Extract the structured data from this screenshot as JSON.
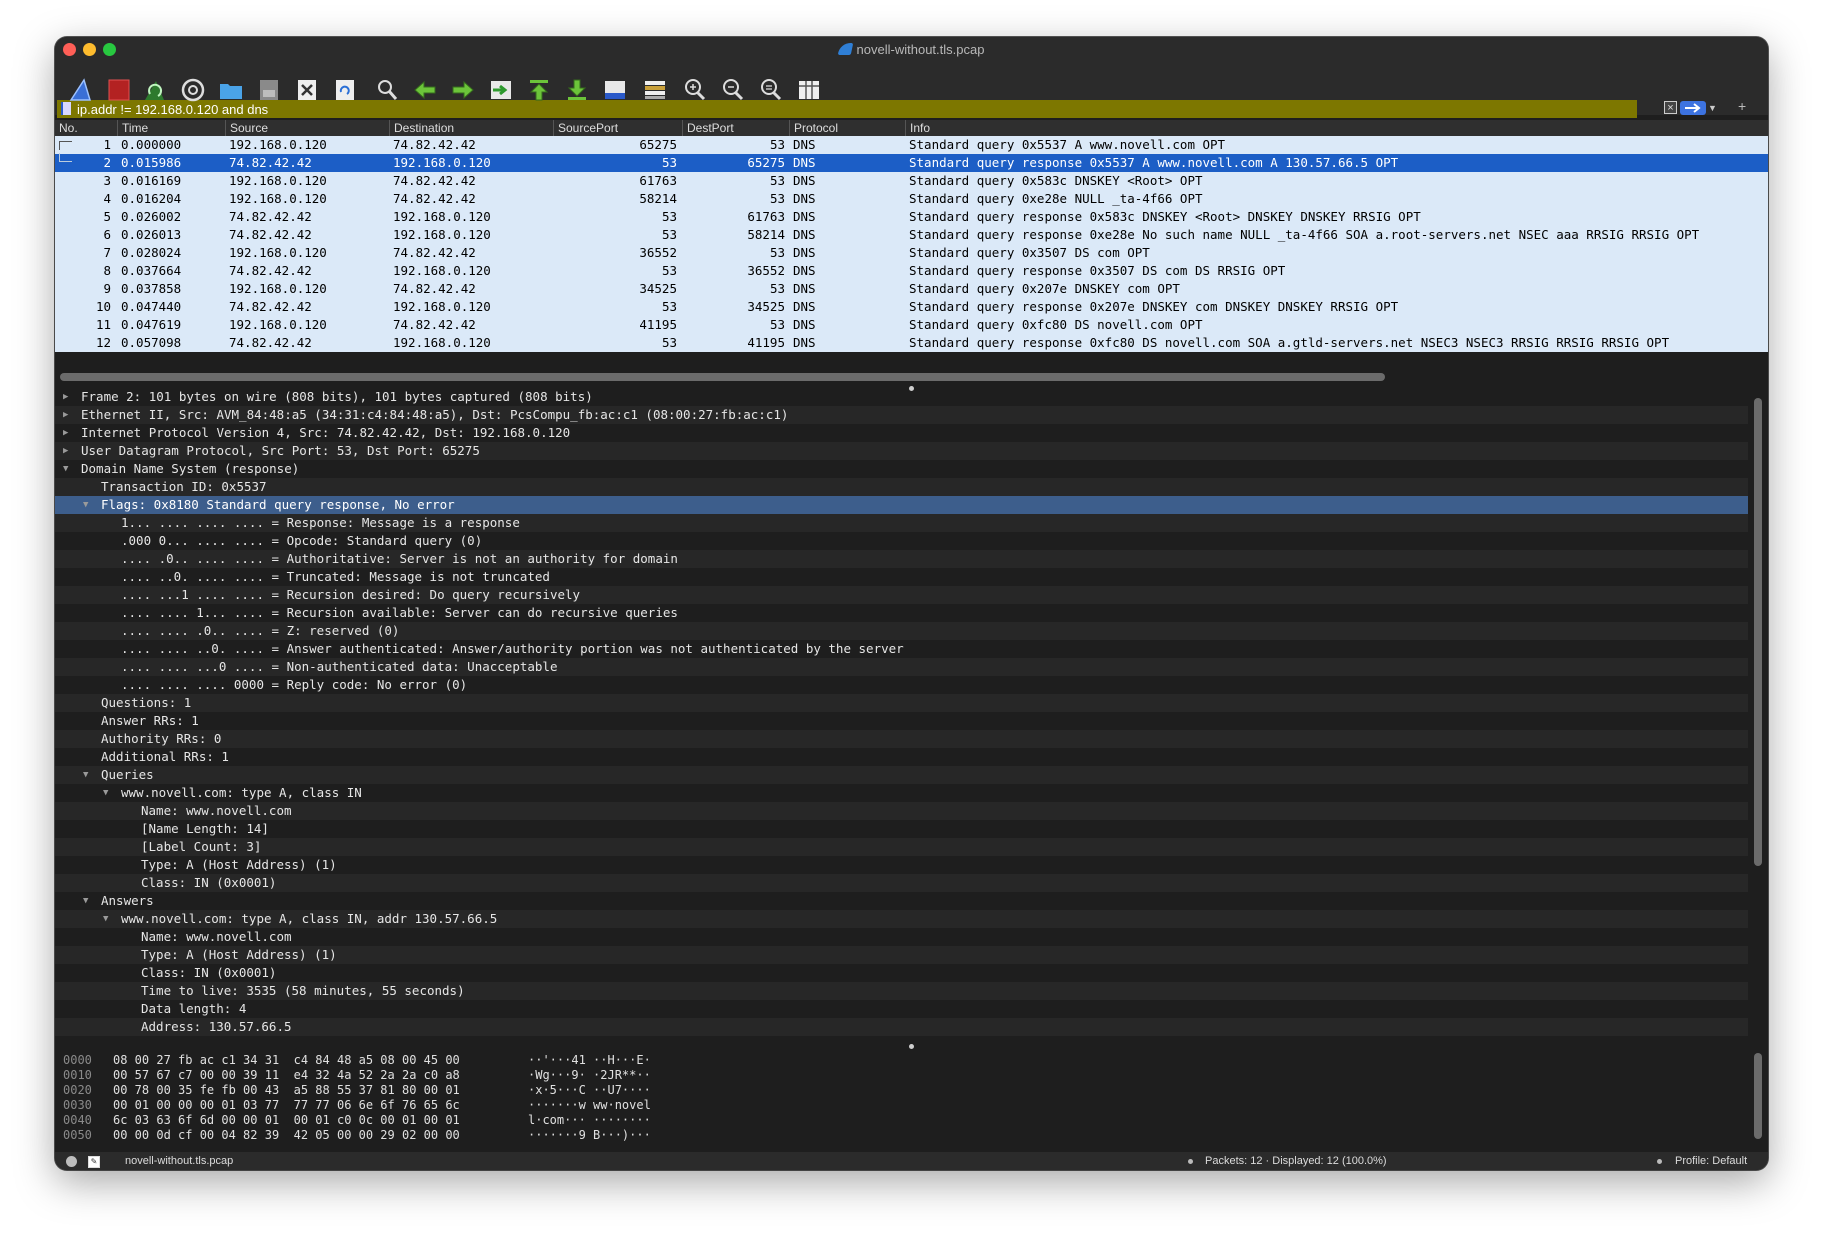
{
  "window": {
    "title": "novell-without.tls.pcap"
  },
  "toolbar": {
    "buttons": [
      {
        "name": "start-capture-icon",
        "label": "Start capture"
      },
      {
        "name": "stop-capture-icon",
        "label": "Stop capture"
      },
      {
        "name": "restart-capture-icon",
        "label": "Restart capture"
      },
      {
        "name": "capture-options-icon",
        "label": "Capture options"
      },
      {
        "name": "open-file-icon",
        "label": "Open"
      },
      {
        "name": "save-file-icon",
        "label": "Save"
      },
      {
        "name": "close-file-icon",
        "label": "Close"
      },
      {
        "name": "reload-file-icon",
        "label": "Reload"
      },
      {
        "name": "find-packet-icon",
        "label": "Find"
      },
      {
        "name": "go-back-icon",
        "label": "Back"
      },
      {
        "name": "go-forward-icon",
        "label": "Forward"
      },
      {
        "name": "go-to-packet-icon",
        "label": "Go to packet"
      },
      {
        "name": "first-packet-icon",
        "label": "First"
      },
      {
        "name": "last-packet-icon",
        "label": "Last"
      },
      {
        "name": "auto-scroll-icon",
        "label": "Auto scroll"
      },
      {
        "name": "colorize-icon",
        "label": "Colorize"
      },
      {
        "name": "zoom-in-icon",
        "label": "Zoom in"
      },
      {
        "name": "zoom-out-icon",
        "label": "Zoom out"
      },
      {
        "name": "zoom-reset-icon",
        "label": "Normal size"
      },
      {
        "name": "resize-columns-icon",
        "label": "Resize columns"
      }
    ]
  },
  "filter": {
    "value": "ip.addr != 192.168.0.120 and dns"
  },
  "packet_list": {
    "columns": [
      "No.",
      "Time",
      "Source",
      "Destination",
      "SourcePort",
      "DestPort",
      "Protocol",
      "Info"
    ],
    "rows": [
      {
        "no": "1",
        "time": "0.000000",
        "src": "192.168.0.120",
        "dst": "74.82.42.42",
        "sport": "65275",
        "dport": "53",
        "proto": "DNS",
        "info": "Standard query 0x5537 A www.novell.com OPT"
      },
      {
        "no": "2",
        "time": "0.015986",
        "src": "74.82.42.42",
        "dst": "192.168.0.120",
        "sport": "53",
        "dport": "65275",
        "proto": "DNS",
        "info": "Standard query response 0x5537 A www.novell.com A 130.57.66.5 OPT"
      },
      {
        "no": "3",
        "time": "0.016169",
        "src": "192.168.0.120",
        "dst": "74.82.42.42",
        "sport": "61763",
        "dport": "53",
        "proto": "DNS",
        "info": "Standard query 0x583c DNSKEY <Root> OPT"
      },
      {
        "no": "4",
        "time": "0.016204",
        "src": "192.168.0.120",
        "dst": "74.82.42.42",
        "sport": "58214",
        "dport": "53",
        "proto": "DNS",
        "info": "Standard query 0xe28e NULL _ta-4f66 OPT"
      },
      {
        "no": "5",
        "time": "0.026002",
        "src": "74.82.42.42",
        "dst": "192.168.0.120",
        "sport": "53",
        "dport": "61763",
        "proto": "DNS",
        "info": "Standard query response 0x583c DNSKEY <Root> DNSKEY DNSKEY RRSIG OPT"
      },
      {
        "no": "6",
        "time": "0.026013",
        "src": "74.82.42.42",
        "dst": "192.168.0.120",
        "sport": "53",
        "dport": "58214",
        "proto": "DNS",
        "info": "Standard query response 0xe28e No such name NULL _ta-4f66 SOA a.root-servers.net NSEC aaa RRSIG RRSIG OPT"
      },
      {
        "no": "7",
        "time": "0.028024",
        "src": "192.168.0.120",
        "dst": "74.82.42.42",
        "sport": "36552",
        "dport": "53",
        "proto": "DNS",
        "info": "Standard query 0x3507 DS com OPT"
      },
      {
        "no": "8",
        "time": "0.037664",
        "src": "74.82.42.42",
        "dst": "192.168.0.120",
        "sport": "53",
        "dport": "36552",
        "proto": "DNS",
        "info": "Standard query response 0x3507 DS com DS RRSIG OPT"
      },
      {
        "no": "9",
        "time": "0.037858",
        "src": "192.168.0.120",
        "dst": "74.82.42.42",
        "sport": "34525",
        "dport": "53",
        "proto": "DNS",
        "info": "Standard query 0x207e DNSKEY com OPT"
      },
      {
        "no": "10",
        "time": "0.047440",
        "src": "74.82.42.42",
        "dst": "192.168.0.120",
        "sport": "53",
        "dport": "34525",
        "proto": "DNS",
        "info": "Standard query response 0x207e DNSKEY com DNSKEY DNSKEY RRSIG OPT"
      },
      {
        "no": "11",
        "time": "0.047619",
        "src": "192.168.0.120",
        "dst": "74.82.42.42",
        "sport": "41195",
        "dport": "53",
        "proto": "DNS",
        "info": "Standard query 0xfc80 DS novell.com OPT"
      },
      {
        "no": "12",
        "time": "0.057098",
        "src": "74.82.42.42",
        "dst": "192.168.0.120",
        "sport": "53",
        "dport": "41195",
        "proto": "DNS",
        "info": "Standard query response 0xfc80 DS novell.com SOA a.gtld-servers.net NSEC3 NSEC3 RRSIG RRSIG RRSIG OPT"
      }
    ],
    "selected_row": 2
  },
  "details": [
    {
      "text": "Frame 2: 101 bytes on wire (808 bits), 101 bytes captured (808 bits)",
      "level": 0,
      "tri": "closed"
    },
    {
      "text": "Ethernet II, Src: AVM_84:48:a5 (34:31:c4:84:48:a5), Dst: PcsCompu_fb:ac:c1 (08:00:27:fb:ac:c1)",
      "level": 0,
      "tri": "closed"
    },
    {
      "text": "Internet Protocol Version 4, Src: 74.82.42.42, Dst: 192.168.0.120",
      "level": 0,
      "tri": "closed"
    },
    {
      "text": "User Datagram Protocol, Src Port: 53, Dst Port: 65275",
      "level": 0,
      "tri": "closed"
    },
    {
      "text": "Domain Name System (response)",
      "level": 0,
      "tri": "open"
    },
    {
      "text": "Transaction ID: 0x5537",
      "level": 1,
      "tri": ""
    },
    {
      "text": "Flags: 0x8180 Standard query response, No error",
      "level": 1,
      "tri": "open",
      "selected": true
    },
    {
      "text": "1... .... .... .... = Response: Message is a response",
      "level": 2,
      "tri": ""
    },
    {
      "text": ".000 0... .... .... = Opcode: Standard query (0)",
      "level": 2,
      "tri": ""
    },
    {
      "text": ".... .0.. .... .... = Authoritative: Server is not an authority for domain",
      "level": 2,
      "tri": ""
    },
    {
      "text": ".... ..0. .... .... = Truncated: Message is not truncated",
      "level": 2,
      "tri": ""
    },
    {
      "text": ".... ...1 .... .... = Recursion desired: Do query recursively",
      "level": 2,
      "tri": ""
    },
    {
      "text": ".... .... 1... .... = Recursion available: Server can do recursive queries",
      "level": 2,
      "tri": ""
    },
    {
      "text": ".... .... .0.. .... = Z: reserved (0)",
      "level": 2,
      "tri": ""
    },
    {
      "text": ".... .... ..0. .... = Answer authenticated: Answer/authority portion was not authenticated by the server",
      "level": 2,
      "tri": ""
    },
    {
      "text": ".... .... ...0 .... = Non-authenticated data: Unacceptable",
      "level": 2,
      "tri": ""
    },
    {
      "text": ".... .... .... 0000 = Reply code: No error (0)",
      "level": 2,
      "tri": ""
    },
    {
      "text": "Questions: 1",
      "level": 1,
      "tri": ""
    },
    {
      "text": "Answer RRs: 1",
      "level": 1,
      "tri": ""
    },
    {
      "text": "Authority RRs: 0",
      "level": 1,
      "tri": ""
    },
    {
      "text": "Additional RRs: 1",
      "level": 1,
      "tri": ""
    },
    {
      "text": "Queries",
      "level": 1,
      "tri": "open"
    },
    {
      "text": "www.novell.com: type A, class IN",
      "level": 2,
      "tri": "open"
    },
    {
      "text": "Name: www.novell.com",
      "level": 3,
      "tri": ""
    },
    {
      "text": "[Name Length: 14]",
      "level": 3,
      "tri": ""
    },
    {
      "text": "[Label Count: 3]",
      "level": 3,
      "tri": ""
    },
    {
      "text": "Type: A (Host Address) (1)",
      "level": 3,
      "tri": ""
    },
    {
      "text": "Class: IN (0x0001)",
      "level": 3,
      "tri": ""
    },
    {
      "text": "Answers",
      "level": 1,
      "tri": "open"
    },
    {
      "text": "www.novell.com: type A, class IN, addr 130.57.66.5",
      "level": 2,
      "tri": "open"
    },
    {
      "text": "Name: www.novell.com",
      "level": 3,
      "tri": ""
    },
    {
      "text": "Type: A (Host Address) (1)",
      "level": 3,
      "tri": ""
    },
    {
      "text": "Class: IN (0x0001)",
      "level": 3,
      "tri": ""
    },
    {
      "text": "Time to live: 3535 (58 minutes, 55 seconds)",
      "level": 3,
      "tri": ""
    },
    {
      "text": "Data length: 4",
      "level": 3,
      "tri": ""
    },
    {
      "text": "Address: 130.57.66.5",
      "level": 3,
      "tri": ""
    }
  ],
  "bytes": [
    {
      "offset": "0000",
      "hex": "08 00 27 fb ac c1 34 31  c4 84 48 a5 08 00 45 00",
      "ascii": "··'···41 ··H···E·"
    },
    {
      "offset": "0010",
      "hex": "00 57 67 c7 00 00 39 11  e4 32 4a 52 2a 2a c0 a8",
      "ascii": "·Wg···9· ·2JR**··"
    },
    {
      "offset": "0020",
      "hex": "00 78 00 35 fe fb 00 43  a5 88 55 37 81 80 00 01",
      "ascii": "·x·5···C ··U7····"
    },
    {
      "offset": "0030",
      "hex": "00 01 00 00 00 01 03 77  77 77 06 6e 6f 76 65 6c",
      "ascii": "·······w ww·novel"
    },
    {
      "offset": "0040",
      "hex": "6c 03 63 6f 6d 00 00 01  00 01 c0 0c 00 01 00 01",
      "ascii": "l·com··· ········"
    },
    {
      "offset": "0050",
      "hex": "00 00 0d cf 00 04 82 39  42 05 00 00 29 02 00 00",
      "ascii": "·······9 B···)···"
    }
  ],
  "status": {
    "file": "novell-without.tls.pcap",
    "packets": "Packets: 12 · Displayed: 12 (100.0%)",
    "profile": "Profile: Default"
  },
  "colors": {
    "selected_row": "#1c5ec6",
    "row_bg": "#dbe9f8",
    "filter_bg": "#7d7700",
    "detail_selected": "#3d5e8c"
  }
}
